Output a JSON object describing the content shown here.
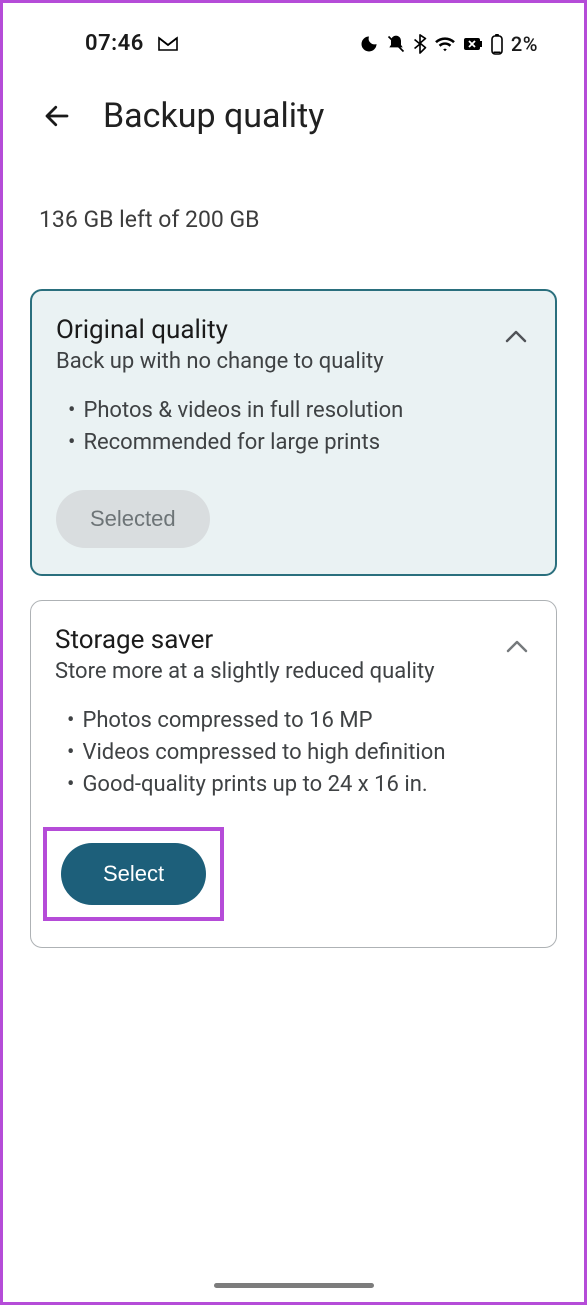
{
  "status": {
    "time": "07:46",
    "battery_pct": "2%"
  },
  "header": {
    "title": "Backup quality"
  },
  "storage_summary": "136 GB left of 200 GB",
  "options": {
    "original": {
      "title": "Original quality",
      "subtitle": "Back up with no change to quality",
      "bullets": [
        "Photos & videos in full resolution",
        "Recommended for large prints"
      ],
      "button": "Selected"
    },
    "saver": {
      "title": "Storage saver",
      "subtitle": "Store more at a slightly reduced quality",
      "bullets": [
        "Photos compressed to 16 MP",
        "Videos compressed to high definition",
        "Good-quality prints up to 24 x 16 in."
      ],
      "button": "Select"
    }
  }
}
